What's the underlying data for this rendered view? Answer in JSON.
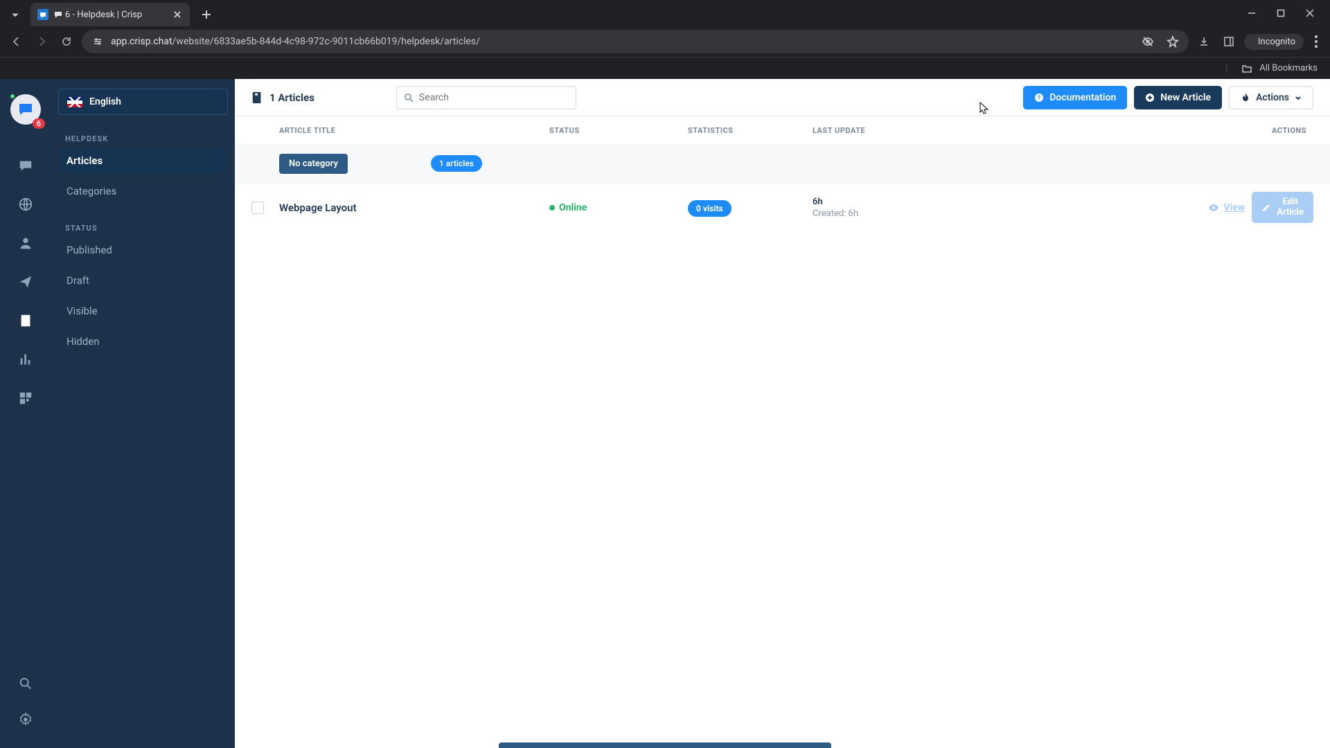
{
  "browser": {
    "tab_title": "6 - Helpdesk | Crisp",
    "url_domain": "app.crisp.chat",
    "url_path": "/website/6833ae5b-844d-4c98-972c-9011cb66b019/helpdesk/articles/",
    "incognito": "Incognito",
    "all_bookmarks": "All Bookmarks"
  },
  "rail": {
    "badge": "6"
  },
  "sidebar": {
    "language": "English",
    "sections": {
      "helpdesk": {
        "label": "HELPDESK",
        "items": [
          "Articles",
          "Categories"
        ]
      },
      "status": {
        "label": "STATUS",
        "items": [
          "Published",
          "Draft",
          "Visible",
          "Hidden"
        ]
      }
    }
  },
  "topbar": {
    "count_label": "1 Articles",
    "search_placeholder": "Search",
    "documentation": "Documentation",
    "new_article": "New Article",
    "actions": "Actions"
  },
  "columns": {
    "title": "ARTICLE TITLE",
    "status": "STATUS",
    "stats": "STATISTICS",
    "update": "LAST UPDATE",
    "actions": "ACTIONS"
  },
  "category_row": {
    "label": "No category",
    "count": "1 articles"
  },
  "article": {
    "title": "Webpage Layout",
    "status": "Online",
    "visits": "0 visits",
    "updated": "6h",
    "created": "Created: 6h",
    "view": "View",
    "edit": "Edit Article"
  }
}
